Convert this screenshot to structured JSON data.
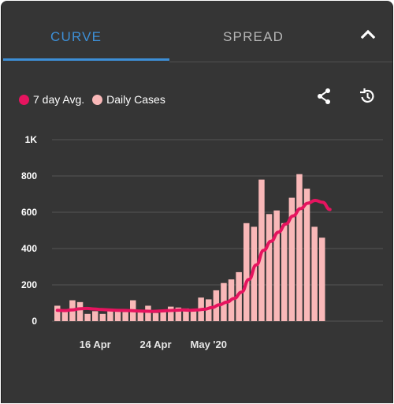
{
  "tabs": [
    {
      "label": "CURVE",
      "active": true
    },
    {
      "label": "SPREAD",
      "active": false
    }
  ],
  "icons": {
    "collapse": "chevron-up-icon",
    "share": "share-icon",
    "history": "history-icon"
  },
  "colors": {
    "accent": "#3d8fd6",
    "avg_line": "#e6145f",
    "bars": "#f9b8b8",
    "panel": "#353535"
  },
  "chart_data": {
    "type": "bar",
    "title": "",
    "xlabel": "",
    "ylabel": "",
    "ylim": [
      0,
      1000
    ],
    "y_ticks": [
      {
        "value": 0,
        "label": "0"
      },
      {
        "value": 200,
        "label": "200"
      },
      {
        "value": 400,
        "label": "400"
      },
      {
        "value": 600,
        "label": "600"
      },
      {
        "value": 800,
        "label": "800"
      },
      {
        "value": 1000,
        "label": "1K"
      }
    ],
    "x_ticks": [
      {
        "index": 5,
        "label": "16 Apr"
      },
      {
        "index": 13,
        "label": "24 Apr"
      },
      {
        "index": 20,
        "label": "May '20"
      }
    ],
    "legend": [
      "7 day Avg.",
      "Daily Cases"
    ],
    "legend_position": "top-left",
    "grid": true,
    "series": [
      {
        "name": "Daily Cases",
        "type": "bar",
        "values": [
          85,
          60,
          115,
          105,
          40,
          55,
          40,
          60,
          60,
          50,
          115,
          50,
          85,
          45,
          50,
          80,
          75,
          70,
          60,
          130,
          120,
          170,
          210,
          230,
          270,
          540,
          520,
          780,
          590,
          610,
          540,
          680,
          810,
          730,
          520,
          460
        ]
      },
      {
        "name": "7 day Avg.",
        "type": "line",
        "values": [
          60,
          58,
          62,
          68,
          70,
          67,
          64,
          62,
          60,
          59,
          58,
          56,
          55,
          54,
          56,
          58,
          60,
          62,
          60,
          62,
          66,
          75,
          90,
          105,
          125,
          160,
          230,
          310,
          390,
          440,
          490,
          535,
          580,
          620,
          650,
          665,
          655,
          615
        ]
      }
    ]
  }
}
